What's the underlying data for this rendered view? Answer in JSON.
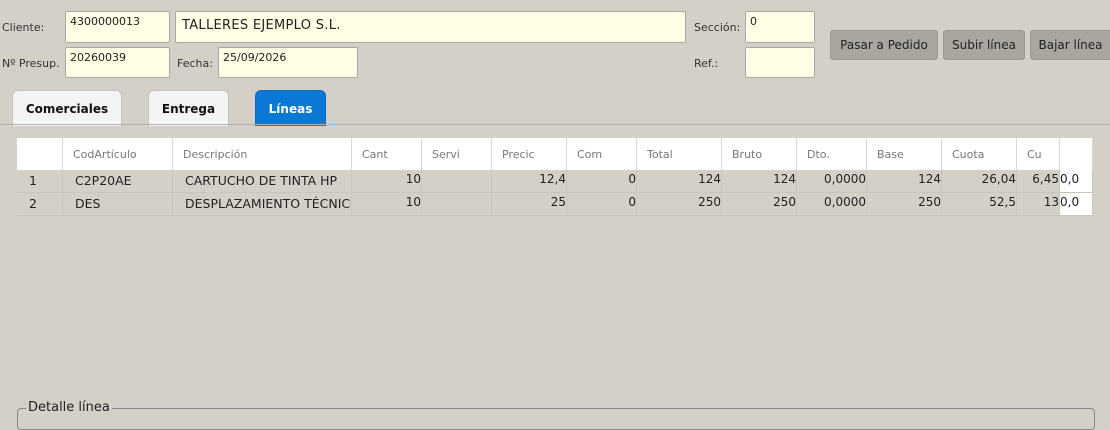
{
  "header": {
    "cliente_label": "Cliente:",
    "cliente_code": "4300000013",
    "cliente_name": "TALLERES EJEMPLO S.L.",
    "presup_label": "Nº Presup.",
    "presup_value": "20260039",
    "fecha_label": "Fecha:",
    "fecha_value": "25/09/2026",
    "seccion_label": "Sección:",
    "seccion_value": "0",
    "ref_label": "Ref.:",
    "ref_value": ""
  },
  "buttons": {
    "pasar_pedido": "Pasar a Pedido",
    "subir_linea": "Subir línea",
    "bajar_linea": "Bajar línea"
  },
  "tabs": [
    {
      "label": "Comerciales",
      "active": false
    },
    {
      "label": "Entrega",
      "active": false
    },
    {
      "label": "Líneas",
      "active": true
    }
  ],
  "grid": {
    "columns": [
      "",
      "CodArtículo",
      "Descripción",
      "Cant",
      "Servi",
      "Precic",
      "Com",
      "Total",
      "Bruto",
      "Dto.",
      "Base",
      "Cuota",
      "Cu",
      ""
    ],
    "rows": [
      [
        "1",
        "C2P20AE",
        "CARTUCHO DE TINTA HP",
        "10",
        "",
        "12,4",
        "0",
        "124",
        "124",
        "0,0000",
        "124",
        "26,04",
        "6,45",
        "0,0"
      ],
      [
        "2",
        "DES",
        "DESPLAZAMIENTO TÉCNICO",
        "10",
        "",
        "25",
        "0",
        "250",
        "250",
        "0,0000",
        "250",
        "52,5",
        "13",
        "0,0"
      ]
    ]
  },
  "detalle": {
    "title": "Detalle línea"
  }
}
